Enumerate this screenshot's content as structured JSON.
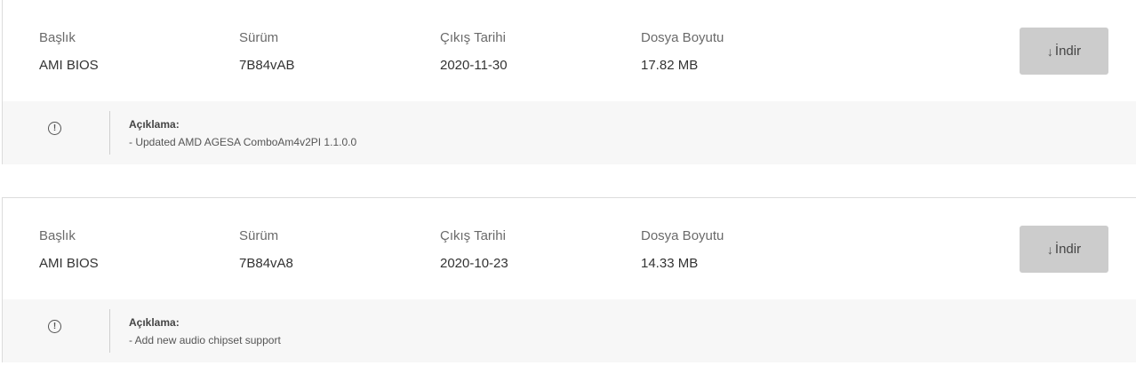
{
  "labels": {
    "title": "Başlık",
    "version": "Sürüm",
    "release_date": "Çıkış Tarihi",
    "file_size": "Dosya Boyutu",
    "description": "Açıklama:",
    "download": "İndir"
  },
  "icons": {
    "download": "download-arrow-icon",
    "info": "exclamation-circle-icon"
  },
  "entries": [
    {
      "title": "AMI BIOS",
      "version": "7B84vAB",
      "release_date": "2020-11-30",
      "file_size": "17.82 MB",
      "description": "- Updated AMD AGESA ComboAm4v2PI 1.1.0.0"
    },
    {
      "title": "AMI BIOS",
      "version": "7B84vA8",
      "release_date": "2020-10-23",
      "file_size": "14.33 MB",
      "description": "- Add new audio chipset support"
    }
  ]
}
